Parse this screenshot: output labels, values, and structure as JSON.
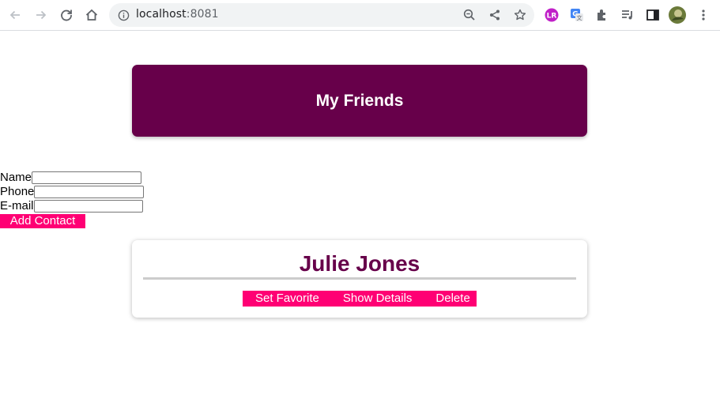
{
  "browser": {
    "url_host": "localhost",
    "url_port": ":8081"
  },
  "page": {
    "title": "My Friends",
    "form": {
      "name_label": "Name",
      "phone_label": "Phone",
      "email_label": "E-mail",
      "name_value": "",
      "phone_value": "",
      "email_value": "",
      "add_button": "Add Contact"
    },
    "contacts": [
      {
        "name": "Julie Jones",
        "set_favorite": "Set Favorite",
        "show_details": "Show Details",
        "delete": "Delete"
      }
    ]
  },
  "colors": {
    "brand": "#67004a",
    "accent": "#ff0074"
  },
  "icons": [
    "back-arrow-icon",
    "forward-arrow-icon",
    "reload-icon",
    "home-icon",
    "info-icon",
    "zoom-icon",
    "share-icon",
    "bookmark-star-icon",
    "extension-lr-icon",
    "translate-icon",
    "puzzle-icon",
    "media-control-icon",
    "side-panel-icon",
    "profile-avatar",
    "kebab-menu-icon"
  ]
}
